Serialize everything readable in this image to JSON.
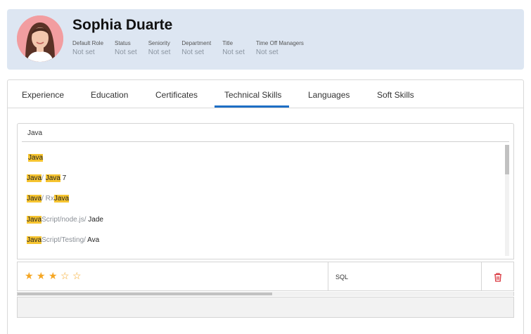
{
  "profile": {
    "name": "Sophia Duarte",
    "fields": [
      {
        "label": "Default Role",
        "value": "Not set"
      },
      {
        "label": "Status",
        "value": "Not set"
      },
      {
        "label": "Seniority",
        "value": "Not set"
      },
      {
        "label": "Department",
        "value": "Not set"
      },
      {
        "label": "Title",
        "value": "Not set"
      },
      {
        "label": "Time Off Managers",
        "value": "Not set"
      }
    ]
  },
  "tabs": [
    {
      "label": "Experience",
      "active": false
    },
    {
      "label": "Education",
      "active": false
    },
    {
      "label": "Certificates",
      "active": false
    },
    {
      "label": "Technical Skills",
      "active": true
    },
    {
      "label": "Languages",
      "active": false
    },
    {
      "label": "Soft Skills",
      "active": false
    }
  ],
  "search": {
    "value": "Java"
  },
  "options": [
    {
      "parts": [
        {
          "t": "Java",
          "hl": true
        }
      ]
    },
    {
      "parts": [
        {
          "t": "Java",
          "hl": true
        },
        {
          "t": "/ ",
          "muted": true
        },
        {
          "t": "Java",
          "hl": true
        },
        {
          "t": " 7"
        }
      ]
    },
    {
      "parts": [
        {
          "t": "Java",
          "hl": true
        },
        {
          "t": "/ Rx",
          "muted": true
        },
        {
          "t": "Java",
          "hl": true
        }
      ]
    },
    {
      "parts": [
        {
          "t": "Java",
          "hl": true
        },
        {
          "t": "Script/node.js/ ",
          "muted": true
        },
        {
          "t": "Jade"
        }
      ]
    },
    {
      "parts": [
        {
          "t": "Java",
          "hl": true
        },
        {
          "t": "Script/Testing/ ",
          "muted": true
        },
        {
          "t": "Ava"
        }
      ]
    }
  ],
  "skill_row": {
    "rating": 3,
    "rating_max": 5,
    "skill": "SQL"
  },
  "colors": {
    "accent": "#1e6fc5",
    "highlight": "#f6c430",
    "star": "#f5a623",
    "delete": "#d9363e"
  },
  "icons": {
    "delete": "trash-icon",
    "star_filled": "star-filled-icon",
    "star_empty": "star-empty-icon"
  }
}
